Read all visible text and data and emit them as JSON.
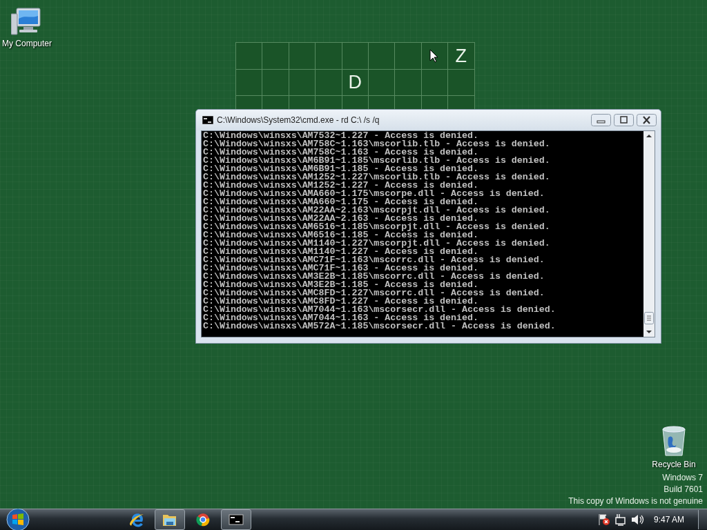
{
  "desktop": {
    "icons": [
      {
        "kind": "computer",
        "label": "My Computer"
      },
      {
        "kind": "recycle-bin",
        "label": "Recycle Bin"
      }
    ],
    "board": {
      "rows": [
        [
          null,
          null,
          null,
          null,
          null,
          null,
          null,
          null,
          "Z"
        ],
        [
          null,
          null,
          null,
          null,
          "D",
          null,
          null,
          null,
          null
        ],
        [
          null,
          null,
          null,
          null,
          null,
          null,
          null,
          null,
          null
        ]
      ]
    },
    "watermark": [
      "Windows 7",
      "Build 7601",
      "This copy of Windows is not genuine"
    ]
  },
  "console_window": {
    "title": "C:\\Windows\\System32\\cmd.exe - rd  C:\\ /s /q",
    "lines": [
      "C:\\Windows\\winsxs\\AM7532~1.227 - Access is denied.",
      "C:\\Windows\\winsxs\\AM758C~1.163\\mscorlib.tlb - Access is denied.",
      "C:\\Windows\\winsxs\\AM758C~1.163 - Access is denied.",
      "C:\\Windows\\winsxs\\AM6B91~1.185\\mscorlib.tlb - Access is denied.",
      "C:\\Windows\\winsxs\\AM6B91~1.185 - Access is denied.",
      "C:\\Windows\\winsxs\\AM1252~1.227\\mscorlib.tlb - Access is denied.",
      "C:\\Windows\\winsxs\\AM1252~1.227 - Access is denied.",
      "C:\\Windows\\winsxs\\AMA660~1.175\\mscorpe.dll - Access is denied.",
      "C:\\Windows\\winsxs\\AMA660~1.175 - Access is denied.",
      "C:\\Windows\\winsxs\\AM22AA~2.163\\mscorpjt.dll - Access is denied.",
      "C:\\Windows\\winsxs\\AM22AA~2.163 - Access is denied.",
      "C:\\Windows\\winsxs\\AM6516~1.185\\mscorpjt.dll - Access is denied.",
      "C:\\Windows\\winsxs\\AM6516~1.185 - Access is denied.",
      "C:\\Windows\\winsxs\\AM1140~1.227\\mscorpjt.dll - Access is denied.",
      "C:\\Windows\\winsxs\\AM1140~1.227 - Access is denied.",
      "C:\\Windows\\winsxs\\AMC71F~1.163\\mscorrc.dll - Access is denied.",
      "C:\\Windows\\winsxs\\AMC71F~1.163 - Access is denied.",
      "C:\\Windows\\winsxs\\AM3E2B~1.185\\mscorrc.dll - Access is denied.",
      "C:\\Windows\\winsxs\\AM3E2B~1.185 - Access is denied.",
      "C:\\Windows\\winsxs\\AMC8FD~1.227\\mscorrc.dll - Access is denied.",
      "C:\\Windows\\winsxs\\AMC8FD~1.227 - Access is denied.",
      "C:\\Windows\\winsxs\\AM7044~1.163\\mscorsecr.dll - Access is denied.",
      "C:\\Windows\\winsxs\\AM7044~1.163 - Access is denied.",
      "C:\\Windows\\winsxs\\AM572A~1.185\\mscorsecr.dll - Access is denied."
    ]
  },
  "taskbar": {
    "items": [
      {
        "kind": "browser-e",
        "running": false
      },
      {
        "kind": "folder",
        "running": true
      },
      {
        "kind": "browser-ball",
        "running": false
      },
      {
        "kind": "console",
        "running": true
      }
    ],
    "tray": [
      {
        "kind": "flag-alert"
      },
      {
        "kind": "network"
      },
      {
        "kind": "volume"
      }
    ],
    "clock": "9:47 AM"
  }
}
